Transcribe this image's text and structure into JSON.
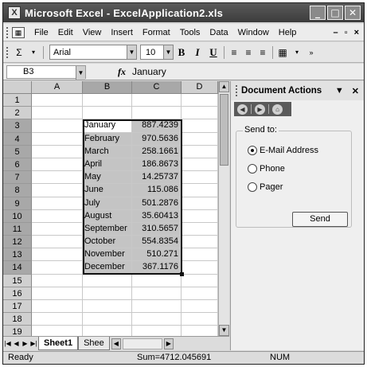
{
  "window": {
    "title": "Microsoft Excel - ExcelApplication2.xls"
  },
  "menu": [
    "File",
    "Edit",
    "View",
    "Insert",
    "Format",
    "Tools",
    "Data",
    "Window",
    "Help"
  ],
  "toolbar": {
    "font": "Arial",
    "size": "10"
  },
  "formula_bar": {
    "name_box": "B3",
    "fx": "fx",
    "content": "January"
  },
  "grid": {
    "columns": [
      "A",
      "B",
      "C",
      "D"
    ],
    "rows": [
      {
        "num": "1",
        "b": "",
        "c": ""
      },
      {
        "num": "2",
        "b": "",
        "c": ""
      },
      {
        "num": "3",
        "b": "January",
        "c": "887.4239"
      },
      {
        "num": "4",
        "b": "February",
        "c": "970.5636"
      },
      {
        "num": "5",
        "b": "March",
        "c": "258.1661"
      },
      {
        "num": "6",
        "b": "April",
        "c": "186.8673"
      },
      {
        "num": "7",
        "b": "May",
        "c": "14.25737"
      },
      {
        "num": "8",
        "b": "June",
        "c": "115.086"
      },
      {
        "num": "9",
        "b": "July",
        "c": "501.2876"
      },
      {
        "num": "10",
        "b": "August",
        "c": "35.60413"
      },
      {
        "num": "11",
        "b": "September",
        "c": "310.5657"
      },
      {
        "num": "12",
        "b": "October",
        "c": "554.8354"
      },
      {
        "num": "13",
        "b": "November",
        "c": "510.271"
      },
      {
        "num": "14",
        "b": "December",
        "c": "367.1176"
      },
      {
        "num": "15",
        "b": "",
        "c": ""
      },
      {
        "num": "16",
        "b": "",
        "c": ""
      },
      {
        "num": "17",
        "b": "",
        "c": ""
      },
      {
        "num": "18",
        "b": "",
        "c": ""
      },
      {
        "num": "19",
        "b": "",
        "c": ""
      }
    ]
  },
  "sheet_tabs": [
    "Sheet1",
    "Shee"
  ],
  "task_pane": {
    "title": "Document Actions",
    "group_label": "Send to:",
    "options": [
      {
        "label": "E-Mail Address",
        "selected": true
      },
      {
        "label": "Phone",
        "selected": false
      },
      {
        "label": "Pager",
        "selected": false
      }
    ],
    "send_label": "Send"
  },
  "status_bar": {
    "ready": "Ready",
    "sum": "Sum=4712.045691",
    "num": "NUM"
  }
}
